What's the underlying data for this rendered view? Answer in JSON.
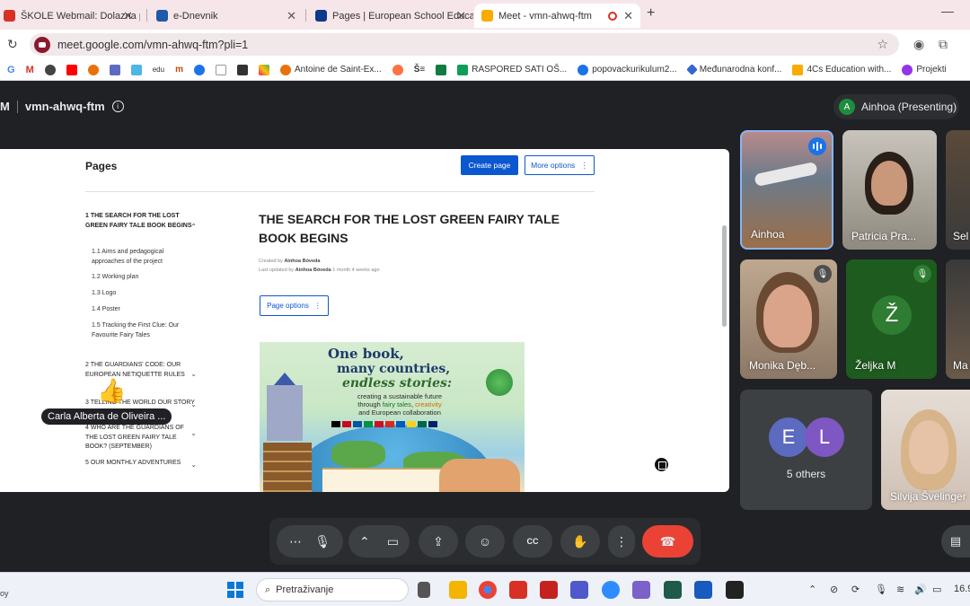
{
  "browser": {
    "tabs": [
      {
        "label": "ŠKOLE Webmail: Dolazna pošta",
        "favicon_color": "#d93025"
      },
      {
        "label": "e-Dnevnik",
        "favicon_color": "#1e5aa8"
      },
      {
        "label": "Pages | European School Educat",
        "favicon_color": "#0b3a8c"
      },
      {
        "label": "Meet - vmn-ahwq-ftm",
        "favicon_color": "#f9ab00"
      }
    ],
    "url": "meet.google.com/vmn-ahwq-ftm?pli=1",
    "bookmarks": [
      {
        "label": "Antoine de Saint-Ex...",
        "color": "#e8710a"
      },
      {
        "label": "RASPORED SATI OŠ...",
        "color": "#0f9d58"
      },
      {
        "label": "popovackurikulum2...",
        "color": "#1a73e8"
      },
      {
        "label": "Međunarodna konf...",
        "color": "#3367d6"
      },
      {
        "label": "4Cs Education with...",
        "color": "#f9ab00"
      },
      {
        "label": "Projekti",
        "color": "#9334e6"
      }
    ],
    "bookmark_short": [
      "G",
      "M",
      "",
      "",
      "",
      "",
      "",
      "edu",
      "m",
      "",
      "",
      "",
      "",
      "",
      "Š≡",
      ""
    ]
  },
  "meet": {
    "logo_letter": "M",
    "meeting_code": "vmn-ahwq-ftm",
    "presenter_initial": "A",
    "presenter_label": "Ainhoa (Presenting)",
    "pointer_name": "Carla Alberta de Oliveira ...",
    "participants": [
      {
        "name": "Ainhoa",
        "state": "speaking"
      },
      {
        "name": "Patricia Pra...",
        "state": "video"
      },
      {
        "name": "Sel",
        "state": "video"
      },
      {
        "name": "Monika Dęb...",
        "state": "muted"
      },
      {
        "name": "Željka M",
        "state": "muted",
        "initial": "Ž"
      },
      {
        "name": "Ma",
        "state": "video"
      },
      {
        "name": "5 others",
        "initials": [
          "E",
          "L"
        ]
      },
      {
        "name": "Silvija Švelinger",
        "state": "video"
      }
    ]
  },
  "shared_page": {
    "header": "Pages",
    "create_button": "Create page",
    "more_button": "More options",
    "toc": [
      {
        "label": "1  THE SEARCH FOR THE LOST GREEN FAIRY TALE BOOK BEGINS",
        "level": 1
      },
      {
        "label": "1.1  Aims and pedagogical approaches of the project",
        "level": 2
      },
      {
        "label": "1.2  Working plan",
        "level": 2
      },
      {
        "label": "1.3  Logo",
        "level": 2
      },
      {
        "label": "1.4  Poster",
        "level": 2
      },
      {
        "label": "1.5  Tracking the First Clue: Our Favourite Fairy Tales",
        "level": 2
      },
      {
        "label": "2  THE GUARDIANS' CODE: OUR EUROPEAN NETIQUETTE RULES",
        "level": 1
      },
      {
        "label": "3  TELLING THE WORLD OUR STORY",
        "level": 1
      },
      {
        "label": "4  WHO ARE THE GUARDIANS OF THE LOST GREEN FAIRY TALE BOOK? (SEPTEMBER)",
        "level": 1
      },
      {
        "label": "5  OUR MONTHLY ADVENTURES",
        "level": 1
      }
    ],
    "title": "THE SEARCH FOR THE LOST GREEN FAIRY TALE BOOK BEGINS",
    "created_by_label": "Created by",
    "created_by": "Ainhoa Bóveda",
    "updated_label": "Last updated by",
    "updated_by": "Ainhoa Bóveda",
    "updated_ago": "1 month 4 weeks ago",
    "page_options": "Page options",
    "poster": {
      "line1": "One book,",
      "line2": "many countries,",
      "line3": "endless stories:",
      "sub1": "creating a sustainable future",
      "sub2_a": "through ",
      "sub2_b": "fairy tales",
      "sub2_c": ", ",
      "sub2_d": "creativity",
      "sub3": "and European collaboration"
    }
  },
  "taskbar": {
    "search_placeholder": "Pretraživanje",
    "clock": "16.9",
    "left_text": "oy"
  },
  "colors": {
    "meet_bg": "#202124",
    "primary_blue": "#0b57d0",
    "end_call_red": "#ea4335",
    "tab_strip": "#f6e6ea"
  }
}
